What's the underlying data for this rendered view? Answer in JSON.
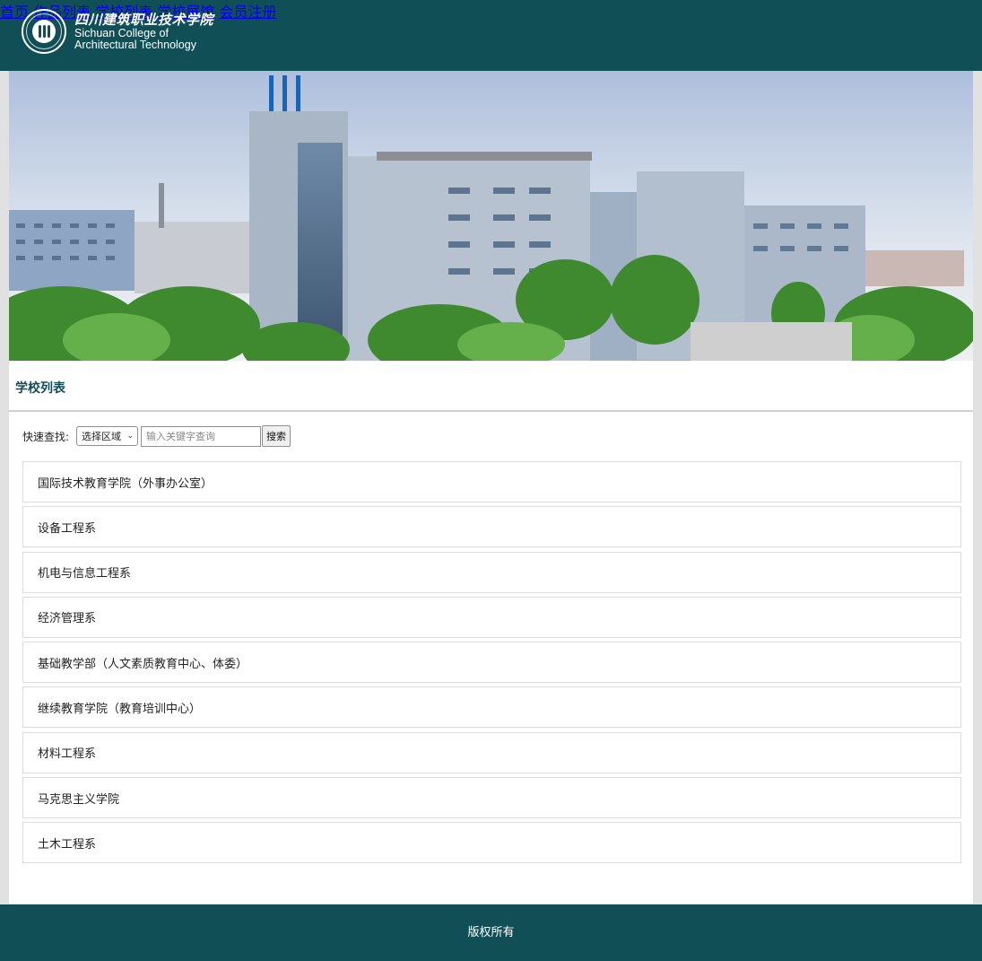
{
  "header": {
    "logo_cn": "四川建筑职业技术学院",
    "logo_en_line1": "Sichuan College of",
    "logo_en_line2": "Architectural Technology",
    "nav": [
      {
        "label": "首页"
      },
      {
        "label": "作品列表"
      },
      {
        "label": "学校列表"
      },
      {
        "label": "学校展馆"
      },
      {
        "label": "会员注册"
      }
    ]
  },
  "main": {
    "section_title": "学校列表",
    "search": {
      "label": "快速查找:",
      "region_selected": "选择区域",
      "keyword_placeholder": "输入关键字查询",
      "button_label": "搜索"
    },
    "schools": [
      {
        "name": "国际技术教育学院（外事办公室）"
      },
      {
        "name": "设备工程系"
      },
      {
        "name": "机电与信息工程系"
      },
      {
        "name": "经济管理系"
      },
      {
        "name": "基础教学部（人文素质教育中心、体委）"
      },
      {
        "name": "继续教育学院（教育培训中心）"
      },
      {
        "name": "材料工程系"
      },
      {
        "name": "马克思主义学院"
      },
      {
        "name": "土木工程系"
      }
    ]
  },
  "footer": {
    "copyright": "版权所有"
  },
  "colors": {
    "brand": "#114f57",
    "page_bg": "#e1e1e1"
  }
}
